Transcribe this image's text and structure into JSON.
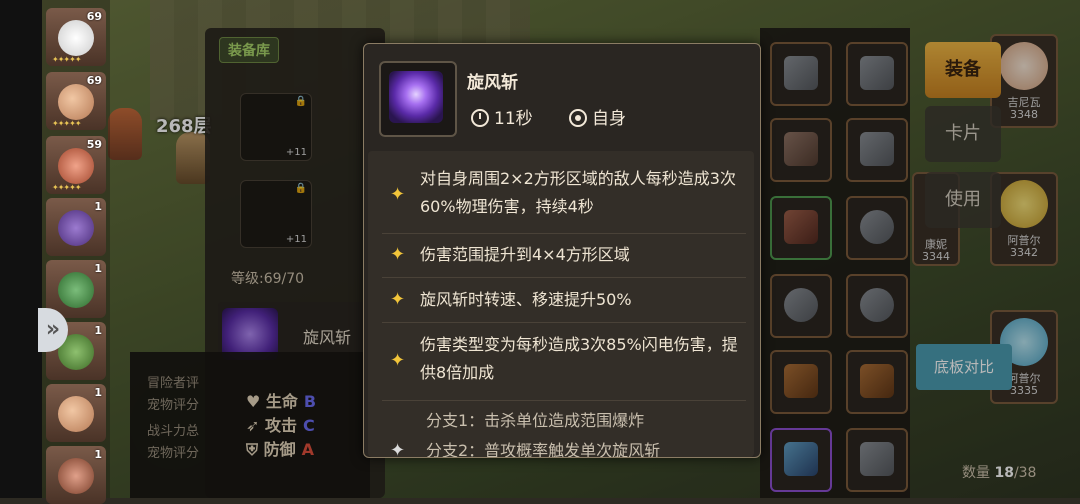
{
  "hero_list": [
    {
      "level": "69"
    },
    {
      "level": "69"
    },
    {
      "level": "59"
    },
    {
      "level": "1"
    },
    {
      "level": "1"
    },
    {
      "level": "1"
    },
    {
      "level": "1"
    },
    {
      "level": "1"
    }
  ],
  "world": {
    "label": "268层"
  },
  "equipment": {
    "tab_label": "装备库",
    "slot1_plus": "+11",
    "slot2_plus": "+11",
    "level_text": "等级:69/70",
    "skill_name": "旋风斩"
  },
  "info_panel": {
    "line1": "冒险者评",
    "line2": "宠物评分",
    "line3": "战斗力总",
    "line4": "宠物评分"
  },
  "stats": [
    {
      "label": "♥ 生命",
      "grade": "B"
    },
    {
      "label": "➶ 攻击",
      "grade": "C"
    },
    {
      "label": "⛨ 防御",
      "grade": "A"
    }
  ],
  "tooltip": {
    "skill_name": "旋风斩",
    "cooldown": "11秒",
    "target": "自身",
    "effects": [
      "对自身周围2×2方形区域的敌人每秒造成3次60%物理伤害，持续4秒",
      "伤害范围提升到4×4方形区域",
      "旋风斩时转速、移速提升50%",
      "伤害类型变为每秒造成3次85%闪电伤害，提供8倍加成"
    ],
    "branches": [
      "分支1：击杀单位造成范围爆炸",
      "分支2：普攻概率触发单次旋风斩"
    ]
  },
  "side_buttons": {
    "equip": "装备",
    "card": "卡片",
    "use": "使用",
    "compare": "底板对比"
  },
  "cards": [
    {
      "name": "吉尼瓦",
      "power": "3348"
    },
    {
      "name": "康妮",
      "power": "3344"
    },
    {
      "name": "阿普尔",
      "power": "3342"
    },
    {
      "name": "阿普尔",
      "power": "3335"
    }
  ],
  "count": {
    "label": "数量",
    "value": "18",
    "total": "/38"
  }
}
